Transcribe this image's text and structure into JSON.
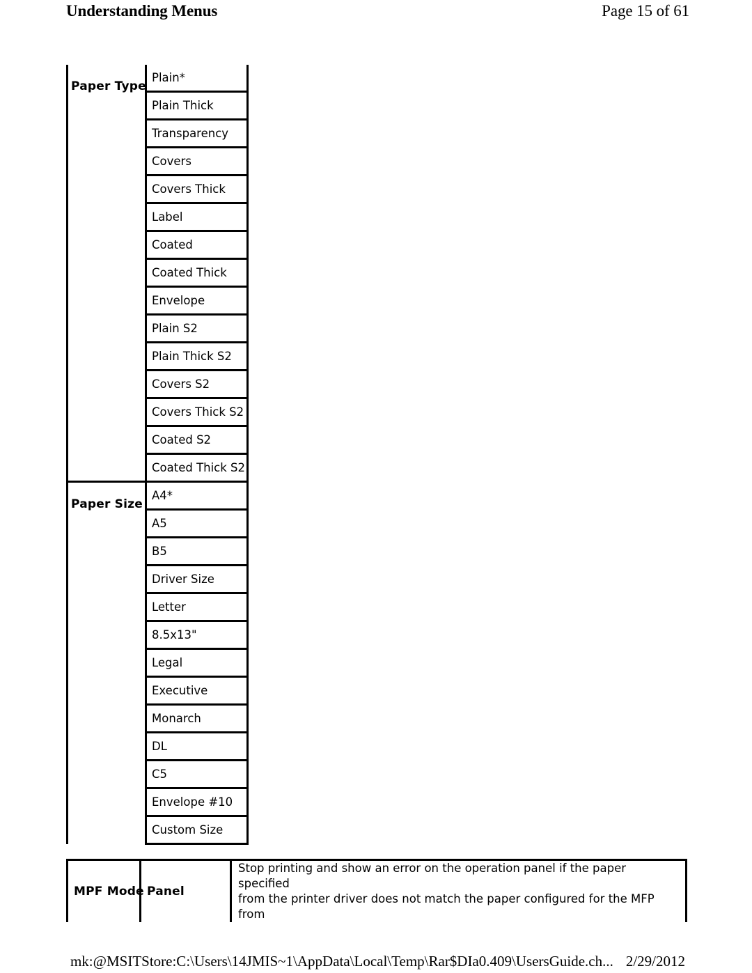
{
  "header": {
    "title": "Understanding Menus",
    "page_indicator": "Page 15 of 61"
  },
  "menu_table": {
    "groups": [
      {
        "label": "Paper Type",
        "options": [
          "Plain*",
          "Plain Thick",
          "Transparency",
          "Covers",
          "Covers Thick",
          "Label",
          "Coated",
          "Coated Thick",
          "Envelope",
          "Plain S2",
          "Plain Thick S2",
          "Covers S2",
          "Covers Thick S2",
          "Coated S2",
          "Coated Thick S2"
        ]
      },
      {
        "label": "Paper Size",
        "options": [
          "A4*",
          "A5",
          "B5",
          "Driver Size",
          "Letter",
          "8.5x13\"",
          "Legal",
          "Executive",
          "Monarch",
          "DL",
          "C5",
          "Envelope #10",
          "Custom Size"
        ]
      }
    ]
  },
  "mpf_table": {
    "row": {
      "name": "MPF Mode",
      "option": "Panel",
      "description_line1": "Stop printing and show an error on the operation panel if the paper specified",
      "description_line2": "from the printer driver does not match the paper configured for the MFP from"
    }
  },
  "footer": {
    "source_path": "mk:@MSITStore:C:\\Users\\14JMIS~1\\AppData\\Local\\Temp\\Rar$DIa0.409\\UsersGuide.ch...",
    "date": "2/29/2012"
  }
}
